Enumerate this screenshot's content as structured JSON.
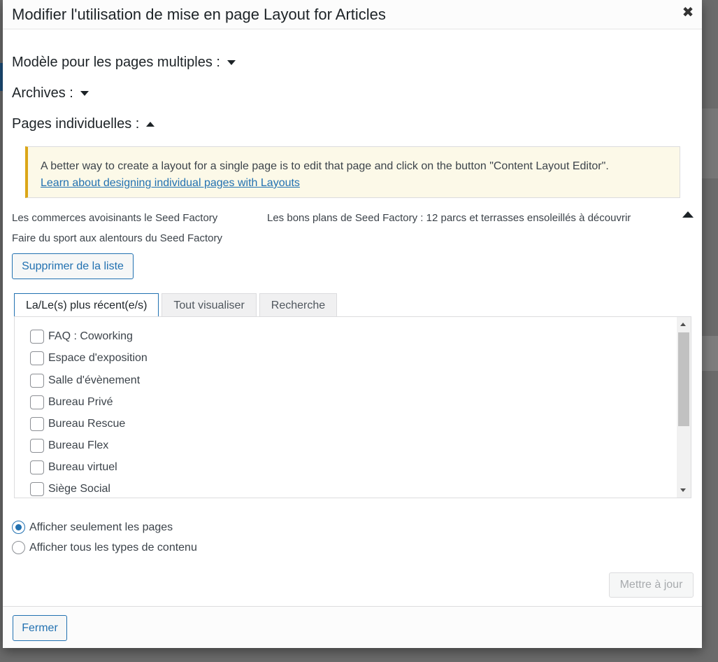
{
  "dialog": {
    "title": "Modifier l'utilisation de mise en page Layout for Articles",
    "close_symbol": "✖"
  },
  "sections": {
    "multiple_pages": "Modèle pour les pages multiples :",
    "archives": "Archives :",
    "individual_pages": "Pages individuelles :"
  },
  "notice": {
    "text": "A better way to create a layout for a single page is to edit that page and click on the button \"Content Layout Editor\".",
    "link": "Learn about designing individual pages with Layouts "
  },
  "assigned_pages": [
    "Les commerces avoisinants le Seed Factory",
    "Les bons plans de Seed Factory : 12 parcs et terrasses ensoleillés à découvrir",
    "Faire du sport aux alentours du Seed Factory"
  ],
  "buttons": {
    "remove": "Supprimer de la liste",
    "update": "Mettre à jour",
    "close": "Fermer"
  },
  "tabs": [
    {
      "label": "La/Le(s) plus récent(e/s)",
      "active": true
    },
    {
      "label": "Tout visualiser",
      "active": false
    },
    {
      "label": "Recherche",
      "active": false
    }
  ],
  "page_list": [
    "FAQ : Coworking",
    "Espace d'exposition",
    "Salle d'évènement",
    "Bureau Privé",
    "Bureau Rescue",
    "Bureau Flex",
    "Bureau virtuel",
    "Siège Social"
  ],
  "filter": {
    "options": [
      "Afficher seulement les pages",
      "Afficher tous les types de contenu"
    ],
    "selected": "Afficher seulement les pages"
  },
  "colors": {
    "accent": "#2271b1",
    "notice_border": "#dba617",
    "notice_bg": "#fcf9e8"
  }
}
